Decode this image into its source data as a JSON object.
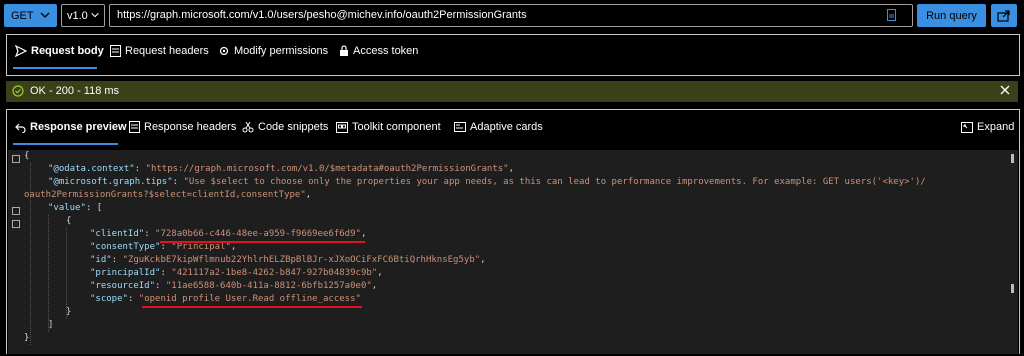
{
  "toolbar": {
    "method": "GET",
    "version": "v1.0",
    "url": "https://graph.microsoft.com/v1.0/users/pesho@michev.info/oauth2PermissionGrants",
    "run_label": "Run query",
    "accent": "#3b8fe0"
  },
  "request_tabs": [
    {
      "label": "Request body",
      "icon": "send-icon"
    },
    {
      "label": "Request headers",
      "icon": "headers-icon"
    },
    {
      "label": "Modify permissions",
      "icon": "settings-icon"
    },
    {
      "label": "Access token",
      "icon": "lock-icon"
    }
  ],
  "status": {
    "text": "OK - 200 - 118 ms",
    "color": "#3a4118"
  },
  "response_tabs": [
    {
      "label": "Response preview",
      "icon": "undo-icon"
    },
    {
      "label": "Response headers",
      "icon": "headers-icon"
    },
    {
      "label": "Code snippets",
      "icon": "code-snippets-icon"
    },
    {
      "label": "Toolkit component",
      "icon": "toolkit-icon"
    },
    {
      "label": "Adaptive cards",
      "icon": "cards-icon"
    }
  ],
  "expand_label": "Expand",
  "response": {
    "brace_open": "{",
    "context_key": "\"@odata.context\"",
    "context_val": "\"https://graph.microsoft.com/v1.0/$metadata#oauth2PermissionGrants\"",
    "tips_key": "\"@microsoft.graph.tips\"",
    "tips_val_1": "\"Use $select to choose only the properties your app needs, as this can lead to performance improvements. For example: GET users('<key>')/",
    "tips_val_2": "oauth2PermissionGrants?$select=clientId,consentType\"",
    "value_key": "\"value\"",
    "clientId_key": "\"clientId\"",
    "clientId_val": "\"728a0b66-c446-48ee-a959-f9669ee6f6d9\"",
    "consentType_key": "\"consentType\"",
    "consentType_val": "\"Principal\"",
    "id_key": "\"id\"",
    "id_val": "\"ZguKckbE7kipWflmnub22YhlrhELZBpBlBJr-xJXoOCiFxFC6BtiQrhHknsEg5yb\"",
    "principalId_key": "\"principalId\"",
    "principalId_val": "\"421117a2-1be8-4262-b847-927b04839c9b\"",
    "resourceId_key": "\"resourceId\"",
    "resourceId_val": "\"11ae6588-640b-411a-8812-6bfb1257a0e0\"",
    "scope_key": "\"scope\"",
    "scope_val": "\"openid profile User.Read offline_access\""
  }
}
